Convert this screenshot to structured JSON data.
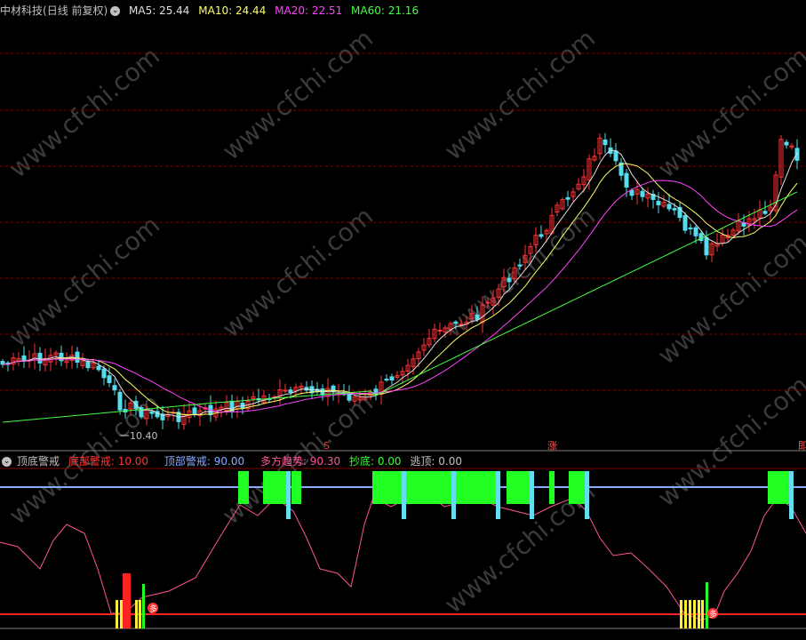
{
  "main_panel": {
    "stock_title": "中材科技",
    "period_label": "(日线 前复权)",
    "indicators": [
      {
        "label": "MA5: 25.44",
        "color": "#e0e0e0"
      },
      {
        "label": "MA10: 24.44",
        "color": "#ffff66"
      },
      {
        "label": "MA20: 22.51",
        "color": "#ff44ff"
      },
      {
        "label": "MA60: 21.16",
        "color": "#44ff44"
      }
    ],
    "low_marker": "10.40",
    "event_markers": [
      "S",
      "涨",
      "即"
    ]
  },
  "sub_panel": {
    "title": "顶底警戒",
    "indicators": [
      {
        "label": "底部警戒: 10.00",
        "color": "#ff3333"
      },
      {
        "label": "顶部警戒: 90.00",
        "color": "#88aaff"
      },
      {
        "label": "多方趋势: 90.30",
        "color": "#ff5599"
      },
      {
        "label": "抄底: 0.00",
        "color": "#33ff33"
      },
      {
        "label": "逃顶: 0.00",
        "color": "#c0c0c0"
      }
    ],
    "buy_marker": "多"
  },
  "watermark": "www.cfchi.com",
  "colors": {
    "up": "#ff3333",
    "down": "#55ddee",
    "grid": "#800000",
    "ma5": "#e0e0e0",
    "ma10": "#ffff66",
    "ma20": "#ff44ff",
    "ma60": "#44ff44",
    "top_line": "#88aaff",
    "bottom_line": "#ff2222",
    "trend": "#ff5599",
    "green_bar": "#22ff22"
  }
}
